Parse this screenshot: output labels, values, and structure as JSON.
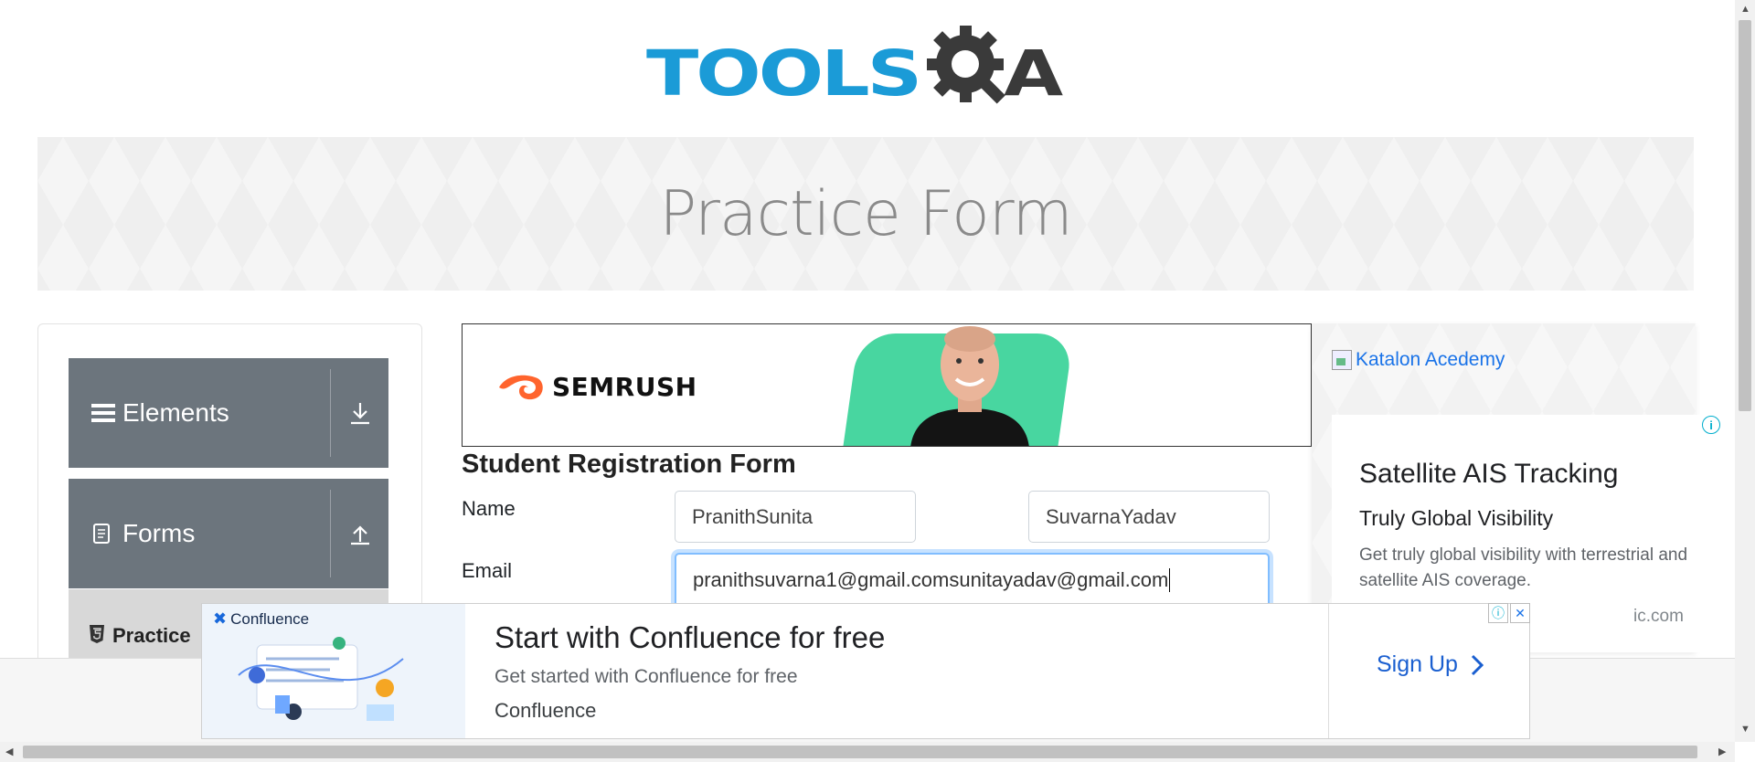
{
  "header": {
    "logo_text": "TOOLS",
    "logo_tail": "A"
  },
  "banner": {
    "title": "Practice Form"
  },
  "sidebar": {
    "groups": [
      {
        "label": "Elements",
        "icon": "hamburger-icon",
        "toggle_icon": "download-arrow-icon"
      },
      {
        "label": "Forms",
        "icon": "document-icon",
        "toggle_icon": "upload-arrow-icon"
      }
    ],
    "active_item": {
      "label": "Practice",
      "icon": "html5-icon"
    }
  },
  "ad_top": {
    "brand": "SEMRUSH"
  },
  "form": {
    "title": "Student Registration Form",
    "name_label": "Name",
    "first_name_value": "PranithSunita",
    "last_name_value": "SuvarnaYadav",
    "email_label": "Email",
    "email_value": "pranithsuvarna1@gmail.comsunitayadav@gmail.com"
  },
  "ad_right": {
    "image_alt": "Katalon Acedemy",
    "headline": "Satellite AIS Tracking",
    "subhead": "Truly Global Visibility",
    "description": "Get truly global visibility with terrestrial and satellite AIS coverage.",
    "source": "ic.com"
  },
  "ad_bottom": {
    "brand_tag": "Confluence",
    "headline": "Start with Confluence for free",
    "subtext": "Get started with Confluence for free",
    "advertiser": "Confluence",
    "cta": "Sign Up"
  },
  "colors": {
    "logo_blue": "#1b9bd7",
    "sidebar_gray": "#6c757d",
    "focus_blue": "#80bdff",
    "cta_blue": "#1a5fd0"
  }
}
